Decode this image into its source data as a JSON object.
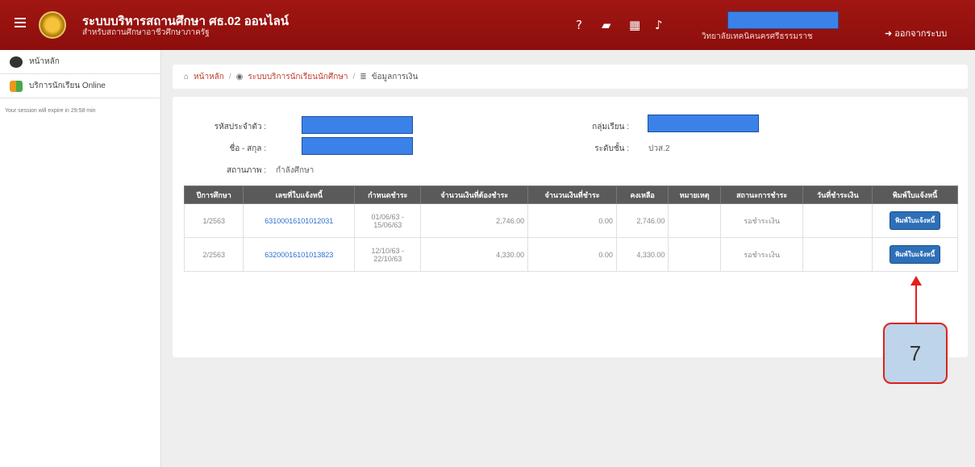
{
  "header": {
    "title": "ระบบบริหารสถานศึกษา ศธ.02 ออนไลน์",
    "subtitle": "สำหรับสถานศึกษาอาชีวศึกษาภาครัฐ",
    "org_name": "วิทยาลัยเทคนิคนครศรีธรรมราช",
    "logout_label": "ออกจากระบบ",
    "icons": [
      "help-icon",
      "book-icon",
      "calendar-icon",
      "bell-icon"
    ]
  },
  "sidebar": {
    "items": [
      {
        "label": "หน้าหลัก",
        "icon": "dashboard-icon"
      },
      {
        "label": "บริการนักเรียน Online",
        "icon": "users-icon"
      }
    ],
    "session_text": "Your session will expire in 29:58 min"
  },
  "breadcrumb": {
    "home": "หน้าหลัก",
    "section": "ระบบบริการนักเรียนนักศึกษา",
    "current": "ข้อมูลการเงิน"
  },
  "student": {
    "id_label": "รหัสประจำตัว :",
    "name_label": "ชื่อ - สกุล :",
    "status_label": "สถานภาพ :",
    "status_value": "กำลังศึกษา",
    "group_label": "กลุ่มเรียน :",
    "level_label": "ระดับชั้น :",
    "level_value": "ปวส.2"
  },
  "table": {
    "headers": [
      "ปีการศึกษา",
      "เลขที่ใบแจ้งหนี้",
      "กำหนดชำระ",
      "จำนวนเงินที่ต้องชำระ",
      "จำนวนเงินที่ชำระ",
      "คงเหลือ",
      "หมายเหตุ",
      "สถานะการชำระ",
      "วันที่ชำระเงิน",
      "พิมพ์ใบแจ้งหนี้"
    ],
    "rows": [
      {
        "year": "1/2563",
        "invoice": "63100016101012031",
        "due_start": "01/06/63 -",
        "due_end": "15/06/63",
        "amount": "2,746.00",
        "paid": "0.00",
        "balance": "2,746.00",
        "note": "",
        "status": "รอชำระเงิน",
        "paid_date": "",
        "print_label": "พิมพ์ใบแจ้งหนี้"
      },
      {
        "year": "2/2563",
        "invoice": "63200016101013823",
        "due_start": "12/10/63 -",
        "due_end": "22/10/63",
        "amount": "4,330.00",
        "paid": "0.00",
        "balance": "4,330.00",
        "note": "",
        "status": "รอชำระเงิน",
        "paid_date": "",
        "print_label": "พิมพ์ใบแจ้งหนี้"
      }
    ]
  },
  "callout": {
    "number": "7"
  },
  "colors": {
    "header_red": "#a11612",
    "redaction_blue": "#3b82e8",
    "callout_red": "#e0201b",
    "callout_fill": "#bdd4ea",
    "print_button": "#2d6fb8"
  }
}
